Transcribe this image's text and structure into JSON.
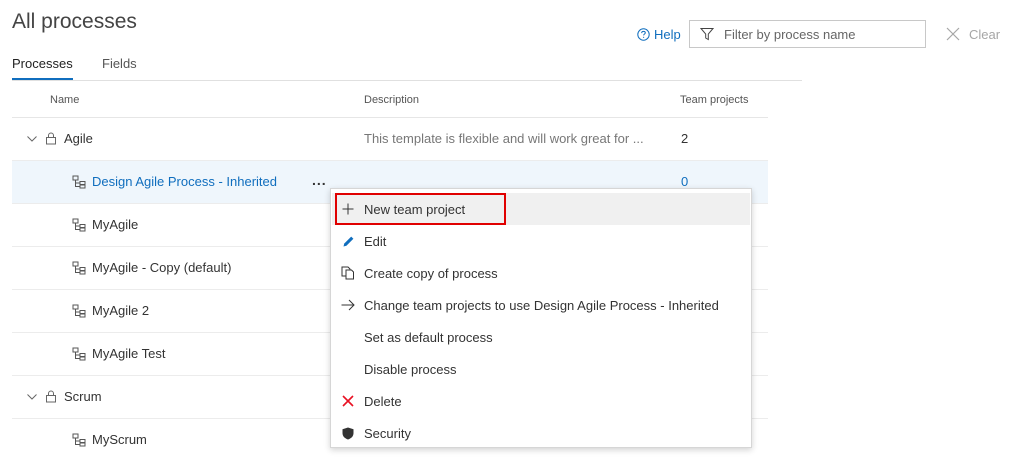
{
  "page": {
    "title": "All processes"
  },
  "tabs": [
    {
      "label": "Processes",
      "active": true
    },
    {
      "label": "Fields",
      "active": false
    }
  ],
  "toolbar": {
    "help_label": "Help",
    "filter_placeholder": "Filter by process name",
    "filter_value": "",
    "clear_label": "Clear"
  },
  "table": {
    "columns": [
      "Name",
      "Description",
      "Team projects"
    ],
    "rows": [
      {
        "name": "Agile",
        "type": "system",
        "expanded": true,
        "description": "This template is flexible and will work great for ...",
        "team_projects": "2"
      },
      {
        "name": "Design Agile Process - Inherited",
        "type": "inherited",
        "selected": true,
        "description": "",
        "team_projects": "0",
        "more_label": "..."
      },
      {
        "name": "MyAgile",
        "type": "inherited",
        "description": "",
        "team_projects": ""
      },
      {
        "name": "MyAgile - Copy (default)",
        "type": "inherited",
        "description": "",
        "team_projects": ""
      },
      {
        "name": "MyAgile 2",
        "type": "inherited",
        "description": "",
        "team_projects": ""
      },
      {
        "name": "MyAgile Test",
        "type": "inherited",
        "description": "",
        "team_projects": ""
      },
      {
        "name": "Scrum",
        "type": "system",
        "expanded": true,
        "description": "",
        "team_projects": ""
      },
      {
        "name": "MyScrum",
        "type": "inherited",
        "description": "",
        "team_projects": ""
      }
    ]
  },
  "context_menu": {
    "items": [
      {
        "label": "New team project",
        "icon": "plus-icon",
        "highlighted": true
      },
      {
        "label": "Edit",
        "icon": "pencil-icon"
      },
      {
        "label": "Create copy of process",
        "icon": "copy-icon"
      },
      {
        "label": "Change team projects to use Design Agile Process - Inherited",
        "icon": "arrow-right-icon"
      },
      {
        "label": "Set as default process",
        "icon": ""
      },
      {
        "label": "Disable process",
        "icon": ""
      },
      {
        "label": "Delete",
        "icon": "delete-x-icon"
      },
      {
        "label": "Security",
        "icon": "shield-icon"
      }
    ]
  },
  "colors": {
    "accent": "#106ebe",
    "selected_row": "#eff6fc",
    "highlight_border": "#e00000",
    "delete_icon": "#e81123"
  }
}
